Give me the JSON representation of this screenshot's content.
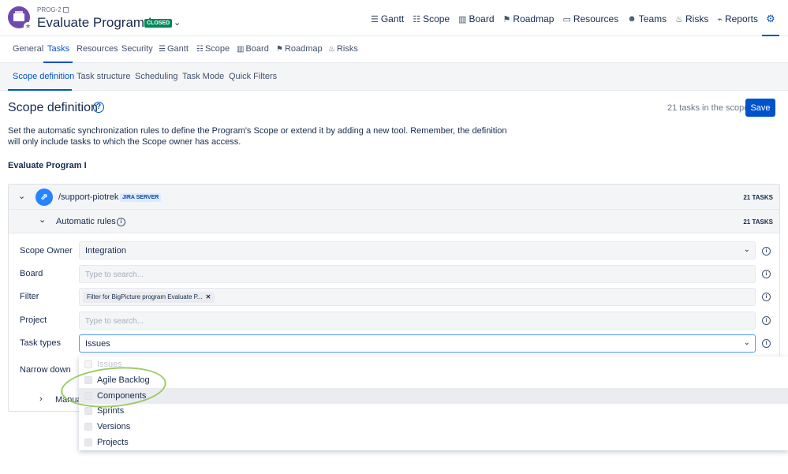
{
  "header": {
    "program_key": "PROG-2",
    "title": "Evaluate Program I",
    "status_badge": "CLOSED",
    "nav": [
      {
        "label": "Gantt",
        "icon": "gantt-icon"
      },
      {
        "label": "Scope",
        "icon": "scope-icon"
      },
      {
        "label": "Board",
        "icon": "board-icon"
      },
      {
        "label": "Roadmap",
        "icon": "roadmap-icon"
      },
      {
        "label": "Resources",
        "icon": "resources-icon"
      },
      {
        "label": "Teams",
        "icon": "teams-icon"
      },
      {
        "label": "Risks",
        "icon": "risks-icon"
      },
      {
        "label": "Reports",
        "icon": "reports-icon"
      }
    ],
    "settings_icon": "gear-icon"
  },
  "tabs": [
    {
      "label": "General"
    },
    {
      "label": "Tasks",
      "active": true
    },
    {
      "label": "Resources"
    },
    {
      "label": "Security"
    },
    {
      "label": "Gantt",
      "icon": "gantt-icon"
    },
    {
      "label": "Scope",
      "icon": "scope-icon"
    },
    {
      "label": "Board",
      "icon": "board-icon"
    },
    {
      "label": "Roadmap",
      "icon": "roadmap-icon"
    },
    {
      "label": "Risks",
      "icon": "risks-icon"
    }
  ],
  "subtabs": [
    {
      "label": "Scope definition",
      "active": true
    },
    {
      "label": "Task structure"
    },
    {
      "label": "Scheduling"
    },
    {
      "label": "Task Mode"
    },
    {
      "label": "Quick Filters"
    }
  ],
  "page": {
    "title": "Scope definition",
    "tasks_in_scope": "21 tasks in the scope",
    "save_label": "Save",
    "description": "Set the automatic synchronization rules to define the Program's Scope or extend it by adding a new tool. Remember, the definition will only include tasks to which the Scope owner has access.",
    "section_name": "Evaluate Program I"
  },
  "source": {
    "name": "/support-piotrek",
    "badge": "JIRA SERVER",
    "task_count": "21 TASKS"
  },
  "automatic_rules": {
    "label": "Automatic rules",
    "task_count": "21 TASKS"
  },
  "fields": {
    "scope_owner": {
      "label": "Scope Owner",
      "value": "Integration"
    },
    "board": {
      "label": "Board",
      "placeholder": "Type to search..."
    },
    "filter": {
      "label": "Filter",
      "chip": "Filter for BigPicture program Evaluate P..."
    },
    "project": {
      "label": "Project",
      "placeholder": "Type to search..."
    },
    "task_types": {
      "label": "Task types",
      "value": "Issues"
    },
    "narrow_down": {
      "label": "Narrow down"
    }
  },
  "manual_label": "Manua",
  "dropdown_options": [
    {
      "label": "Issues",
      "disabled": true
    },
    {
      "label": "Agile Backlog"
    },
    {
      "label": "Components",
      "highlighted": true
    },
    {
      "label": "Sprints"
    },
    {
      "label": "Versions"
    },
    {
      "label": "Projects"
    }
  ],
  "colors": {
    "accent": "#0052cc",
    "brand_logo": "#6e4bab",
    "closed_badge": "#00875a",
    "annotation": "#8bc34a"
  }
}
